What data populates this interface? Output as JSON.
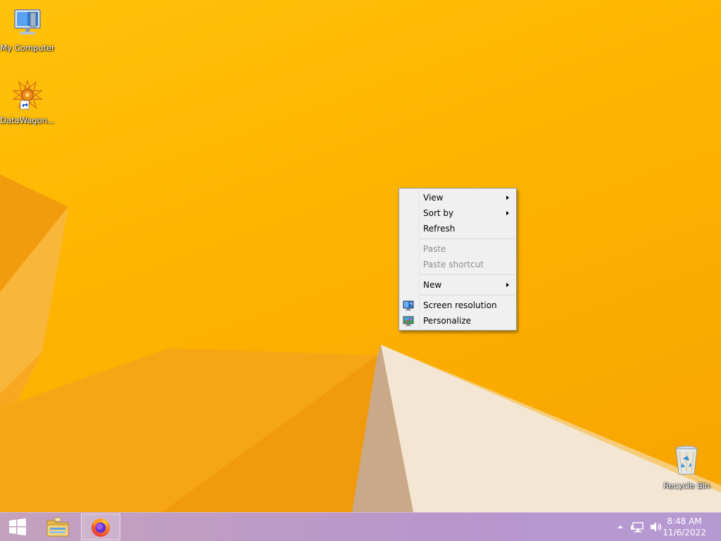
{
  "desktop": {
    "icons": [
      {
        "label": "My Computer",
        "icon": "computer-icon"
      },
      {
        "label": "DataWagon...",
        "icon": "datawagon-icon"
      },
      {
        "label": "Recycle Bin",
        "icon": "recycle-bin-icon"
      }
    ]
  },
  "context_menu": {
    "items": [
      {
        "label": "View",
        "submenu": true,
        "enabled": true
      },
      {
        "label": "Sort by",
        "submenu": true,
        "enabled": true
      },
      {
        "label": "Refresh",
        "submenu": false,
        "enabled": true
      },
      {
        "label": "Paste",
        "submenu": false,
        "enabled": false
      },
      {
        "label": "Paste shortcut",
        "submenu": false,
        "enabled": false
      },
      {
        "label": "New",
        "submenu": true,
        "enabled": true
      },
      {
        "label": "Screen resolution",
        "submenu": false,
        "enabled": true,
        "icon": "screen-resolution-icon"
      },
      {
        "label": "Personalize",
        "submenu": false,
        "enabled": true,
        "icon": "personalize-icon"
      }
    ]
  },
  "taskbar": {
    "start_icon": "windows-logo-icon",
    "pinned": [
      {
        "name": "file-explorer",
        "icon": "folder-icon",
        "active": false
      },
      {
        "name": "firefox",
        "icon": "firefox-icon",
        "active": true
      }
    ],
    "tray_icons": [
      "show-hidden-icons-chevron",
      "network-icon",
      "volume-icon"
    ],
    "clock": {
      "time": "8:48 AM",
      "date": "11/6/2022"
    }
  },
  "colors": {
    "wallpaper": "#fbb300",
    "wallpaper_dark": "#f08a00",
    "wallpaper_light": "#f3e6d1",
    "taskbar": "#bb97c9"
  }
}
